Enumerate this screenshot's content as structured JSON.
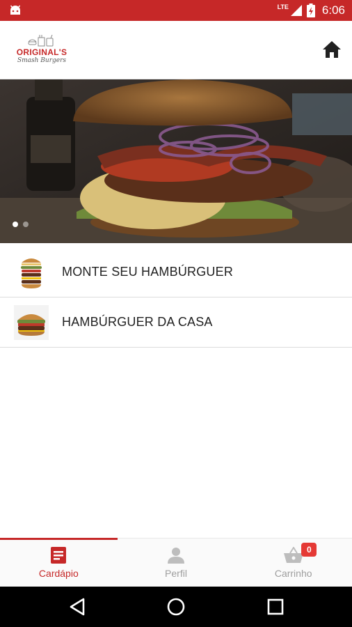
{
  "status_bar": {
    "background": "#c62828",
    "network_label": "LTE",
    "time": "6:06",
    "icons": [
      "android-icon",
      "signal-icon",
      "battery-charging-icon"
    ]
  },
  "app_bar": {
    "logo": {
      "title": "ORIGINAL'S",
      "subtitle": "Smash Burgers"
    },
    "home_icon": "home-icon"
  },
  "banner": {
    "slides_count": 2,
    "active_slide": 1
  },
  "menu": {
    "items": [
      {
        "label": "MONTE SEU HAMBÚRGUER",
        "icon": "stacked-burger-thumbnail"
      },
      {
        "label": "HAMBÚRGUER DA CASA",
        "icon": "house-burger-thumbnail"
      }
    ]
  },
  "bottom_nav": {
    "accent_color": "#c62828",
    "items": [
      {
        "label": "Cardápio",
        "icon": "menu-document-icon",
        "active": true
      },
      {
        "label": "Perfil",
        "icon": "person-icon",
        "active": false
      },
      {
        "label": "Carrinho",
        "icon": "basket-icon",
        "active": false,
        "badge": "0"
      }
    ]
  },
  "system_nav": {
    "buttons": [
      "back-icon",
      "home-circle-icon",
      "recents-icon"
    ]
  }
}
